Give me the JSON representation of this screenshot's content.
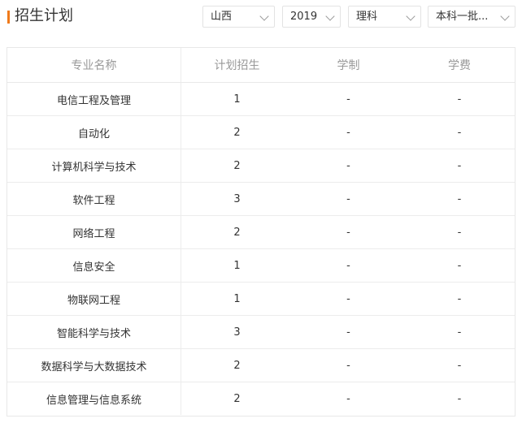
{
  "header": {
    "title": "招生计划"
  },
  "filters": {
    "province": "山西",
    "year": "2019",
    "subject": "理科",
    "batch": "本科一批..."
  },
  "table": {
    "columns": [
      "专业名称",
      "计划招生",
      "学制",
      "学费"
    ],
    "rows": [
      [
        "电信工程及管理",
        "1",
        "-",
        "-"
      ],
      [
        "自动化",
        "2",
        "-",
        "-"
      ],
      [
        "计算机科学与技术",
        "2",
        "-",
        "-"
      ],
      [
        "软件工程",
        "3",
        "-",
        "-"
      ],
      [
        "网络工程",
        "2",
        "-",
        "-"
      ],
      [
        "信息安全",
        "1",
        "-",
        "-"
      ],
      [
        "物联网工程",
        "1",
        "-",
        "-"
      ],
      [
        "智能科学与技术",
        "3",
        "-",
        "-"
      ],
      [
        "数据科学与大数据技术",
        "2",
        "-",
        "-"
      ],
      [
        "信息管理与信息系统",
        "2",
        "-",
        "-"
      ]
    ]
  }
}
